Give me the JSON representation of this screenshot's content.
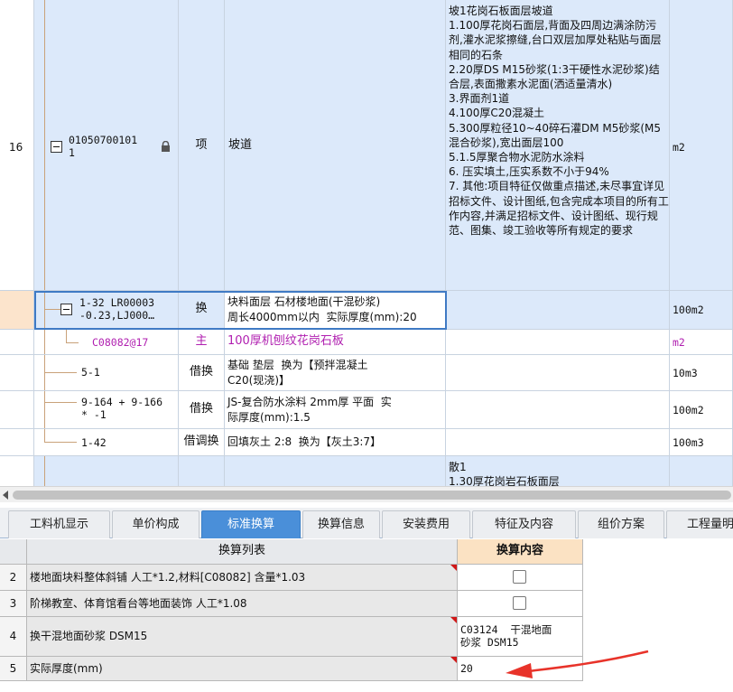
{
  "grid": {
    "row16": {
      "num": "16",
      "code": "01050700101\n1",
      "type": "项",
      "name": "坡道",
      "feature": "坡1花岗石板面层坡道\n1.100厚花岗石面层,背面及四周边满涂防污剂,灌水泥浆擦缝,台口双层加厚处粘贴与面层相同的石条\n2.20厚DS M15砂浆(1:3干硬性水泥砂浆)结合层,表面撒素水泥面(洒适量清水)\n3.界面剂1道\n4.100厚C20混凝土\n5.300厚粒径10~40碎石灌DM M5砂浆(M5混合砂浆),宽出面层100\n5.1.5厚聚合物水泥防水涂料\n6. 压实填土,压实系数不小于94%\n7. 其他:项目特征仅做重点描述,未尽事宜详见招标文件、设计图纸,包含完成本项目的所有工作内容,并满足招标文件、设计图纸、现行规范、图集、竣工验收等所有规定的要求",
      "unit": "m2"
    },
    "sub1": {
      "code": "1-32 LR00003\n-0.23,LJ000…",
      "type": "换",
      "name": "块料面层 石材楼地面(干混砂浆)\n周长4000mm以内  实际厚度(mm):20",
      "unit": "100m2"
    },
    "sub2": {
      "code": "C08082@17",
      "type": "主",
      "name": "100厚机刨纹花岗石板",
      "unit": "m2"
    },
    "sub3": {
      "code": "5-1",
      "type": "借换",
      "name": "基础 垫层  换为【预拌混凝土\nC20(现浇)】",
      "unit": "10m3"
    },
    "sub4": {
      "code": "9-164 + 9-166\n* -1",
      "type": "借换",
      "name": "JS-复合防水涂料 2mm厚 平面  实\n际厚度(mm):1.5",
      "unit": "100m2"
    },
    "sub5": {
      "code": "1-42",
      "type": "借调换",
      "name": "回填灰土 2:8  换为【灰土3:7】",
      "unit": "100m3"
    },
    "next": {
      "feature": "散1\n1.30厚花岗岩石板面层"
    }
  },
  "tabs": [
    "工料机显示",
    "单价构成",
    "标准换算",
    "换算信息",
    "安装费用",
    "特征及内容",
    "组价方案",
    "工程量明"
  ],
  "active_tab": "标准换算",
  "conv": {
    "headers": {
      "list": "换算列表",
      "content": "换算内容"
    },
    "rows": [
      {
        "num": "2",
        "label": "楼地面块料整体斜铺 人工*1.2,材料[C08082] 含量*1.03",
        "content": ""
      },
      {
        "num": "3",
        "label": "阶梯教室、体育馆看台等地面装饰 人工*1.08",
        "content": ""
      },
      {
        "num": "4",
        "label": "换干混地面砂浆 DSM15",
        "content": "C03124  干混地面\n砂浆 DSM15"
      },
      {
        "num": "5",
        "label": "实际厚度(mm)",
        "content": "20"
      }
    ]
  },
  "colors": {
    "accent": "#4a8fd9",
    "selection": "#3f7ac4",
    "annotation_arrow": "#e8332a",
    "main_material": "#b01fb0"
  }
}
